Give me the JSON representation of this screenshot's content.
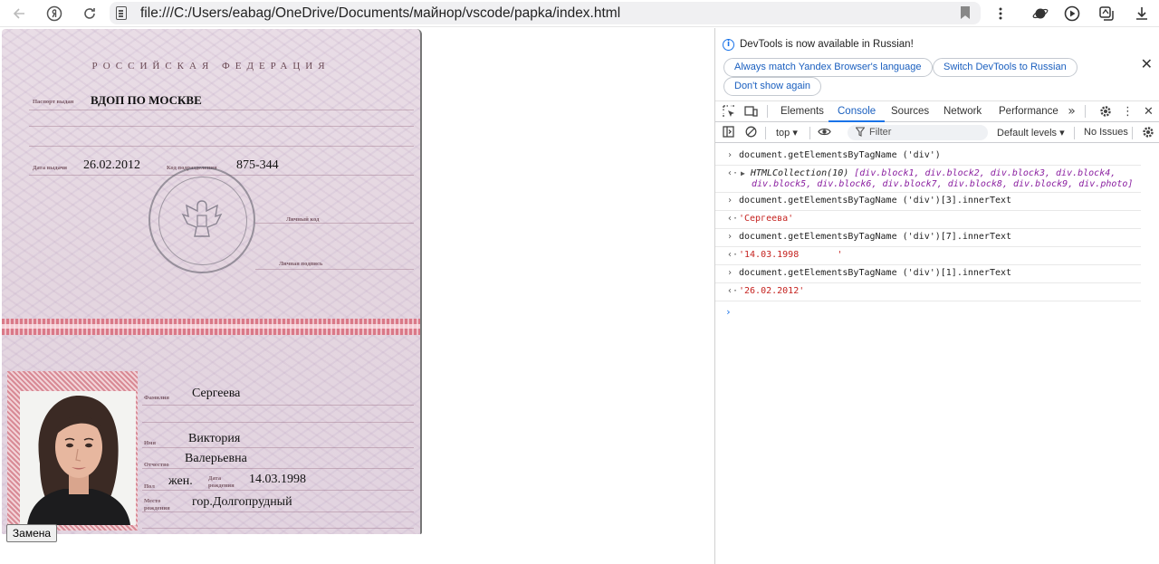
{
  "browser": {
    "url": "file:///C:/Users/eabag/OneDrive/Documents/майнор/vscode/papka/index.html"
  },
  "passport": {
    "country": "РОССИЙСКАЯ ФЕДЕРАЦИЯ",
    "labels": {
      "issued_by": "Паспорт выдан",
      "issue_date": "Дата выдачи",
      "division_code": "Код подразделения",
      "personal_code": "Личный код",
      "personal_signature": "Личная подпись",
      "surname": "Фамилия",
      "name": "Имя",
      "patronymic": "Отчество",
      "sex": "Пол",
      "birth_date": "Дата рождения",
      "birth_place": "Место рождения"
    },
    "issued_by": "ВДОП ПО МОСКВЕ",
    "issue_date": "26.02.2012",
    "division_code": "875-344",
    "surname": "Сергеева",
    "name": "Виктория",
    "patronymic": "Валерьевна",
    "sex": "жен.",
    "birth_date": "14.03.1998",
    "birth_place": "гор.Долгопрудный"
  },
  "page": {
    "replace_button": "Замена"
  },
  "devtools": {
    "banner": {
      "text": "DevTools is now available in Russian!",
      "btn_match": "Always match Yandex Browser's language",
      "btn_switch": "Switch DevTools to Russian",
      "btn_dont_show": "Don't show again"
    },
    "tabs": [
      "Elements",
      "Console",
      "Sources",
      "Network",
      "Performance"
    ],
    "active_tab": "Console",
    "filterbar": {
      "context": "top",
      "filter_placeholder": "Filter",
      "levels": "Default levels",
      "issues": "No Issues"
    },
    "console": [
      {
        "type": "input",
        "text": "document.getElementsByTagName ('div')"
      },
      {
        "type": "output-collection",
        "prefix": "HTMLCollection(10)",
        "line1": "[div.block1, div.block2, div.block3, div.block4,",
        "line2": "div.block5, div.block6, div.block7, div.block8, div.block9, div.photo]"
      },
      {
        "type": "input",
        "text": "document.getElementsByTagName ('div')[3].innerText"
      },
      {
        "type": "output",
        "text": "'Сергеева'"
      },
      {
        "type": "input",
        "text": "document.getElementsByTagName ('div')[7].innerText"
      },
      {
        "type": "output",
        "text": "'14.03.1998       '"
      },
      {
        "type": "input",
        "text": "document.getElementsByTagName ('div')[1].innerText"
      },
      {
        "type": "output",
        "text": "'26.02.2012'"
      }
    ]
  },
  "colors": {
    "accent": "#1a73e8",
    "console_string": "#c5221f"
  }
}
